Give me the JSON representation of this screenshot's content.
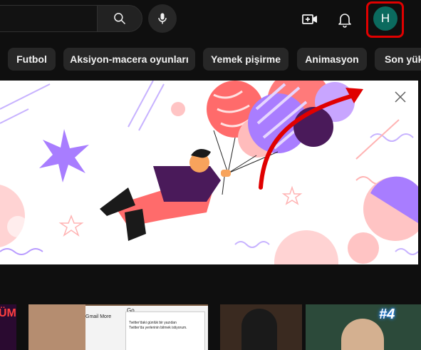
{
  "colors": {
    "background": "#0f0f0f",
    "chip_bg": "#272727",
    "avatar_bg": "#0b6a5e",
    "annotation_red": "#e00000"
  },
  "header": {
    "search_placeholder": "",
    "search_icon": "search-icon",
    "mic_icon": "microphone-icon",
    "create_icon": "video-camera-plus-icon",
    "notifications_icon": "bell-icon",
    "avatar_letter": "H"
  },
  "chips": [
    {
      "label": "Futbol"
    },
    {
      "label": "Aksiyon-macera oyunları"
    },
    {
      "label": "Yemek pişirme"
    },
    {
      "label": "Animasyon"
    },
    {
      "label": "Son yük"
    }
  ],
  "banner": {
    "close_icon": "close-icon",
    "illustration": "person-flying-with-balloons"
  },
  "thumbnails": {
    "partial_text": "ÜM",
    "browser_tab": "Go",
    "browser_menu": "Gmail   More",
    "tweet_lines": [
      "Twitter'daki günlük bir yazıdan",
      "Twitter'da yerlerinin bilmek istiyorum."
    ],
    "episode_badge": "#4"
  }
}
